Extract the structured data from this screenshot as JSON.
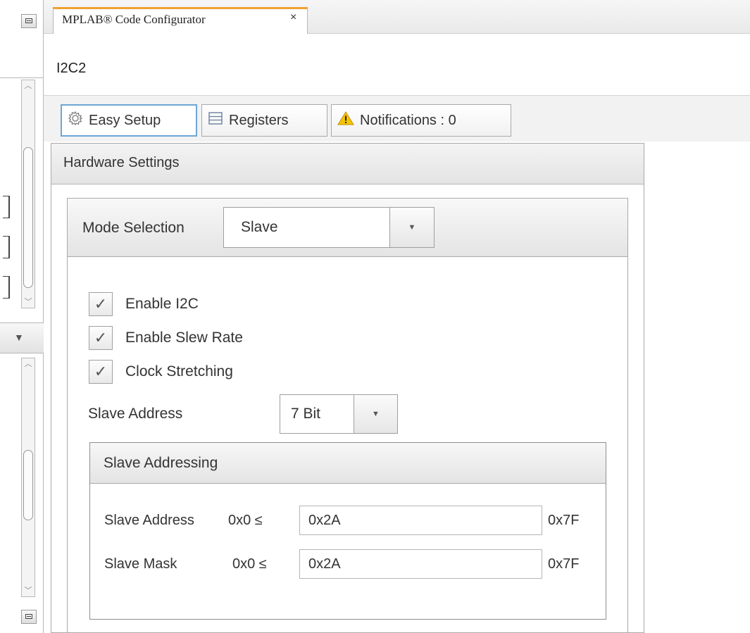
{
  "document_tab": {
    "label": "MPLAB® Code Configurator",
    "close": "×"
  },
  "page_title": "I2C2",
  "tabs": [
    {
      "label": "Easy Setup",
      "icon": "gear-icon"
    },
    {
      "label": "Registers",
      "icon": "register-list-icon"
    },
    {
      "label": "Notifications : 0",
      "icon": "warning-icon"
    }
  ],
  "hardware": {
    "title": "Hardware Settings",
    "mode_label": "Mode Selection",
    "mode_value": "Slave",
    "checkboxes": [
      {
        "label": "Enable I2C",
        "checked": true
      },
      {
        "label": "Enable Slew Rate",
        "checked": true
      },
      {
        "label": "Clock Stretching",
        "checked": true
      }
    ],
    "slave_address_label": "Slave Address",
    "slave_address_bits": "7 Bit"
  },
  "slave_addressing": {
    "title": "Slave Addressing",
    "rows": [
      {
        "label": "Slave Address",
        "min": "0x0 ≤",
        "value": "0x2A",
        "max": "0x7F"
      },
      {
        "label": "Slave Mask",
        "min": "0x0 ≤",
        "value": "0x2A",
        "max": "0x7F"
      }
    ]
  },
  "colors": {
    "active_tab_border": "#6ea6d6",
    "doc_tab_accent": "#f0a030",
    "warning": "#f5c400"
  }
}
